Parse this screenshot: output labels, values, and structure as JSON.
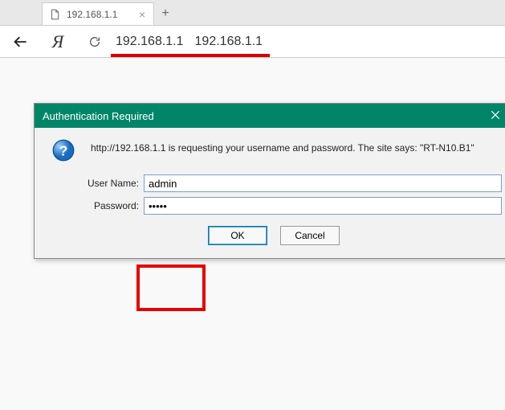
{
  "tab": {
    "title": "192.168.1.1"
  },
  "toolbar": {
    "yandex_glyph": "Я",
    "addr1": "192.168.1.1",
    "addr2": "192.168.1.1"
  },
  "dialog": {
    "title": "Authentication Required",
    "message": "http://192.168.1.1 is requesting your username and password. The site says: \"RT-N10.B1\"",
    "username_label": "User Name:",
    "password_label": "Password:",
    "username_value": "admin",
    "password_value": "•••••",
    "ok_label": "OK",
    "cancel_label": "Cancel"
  }
}
